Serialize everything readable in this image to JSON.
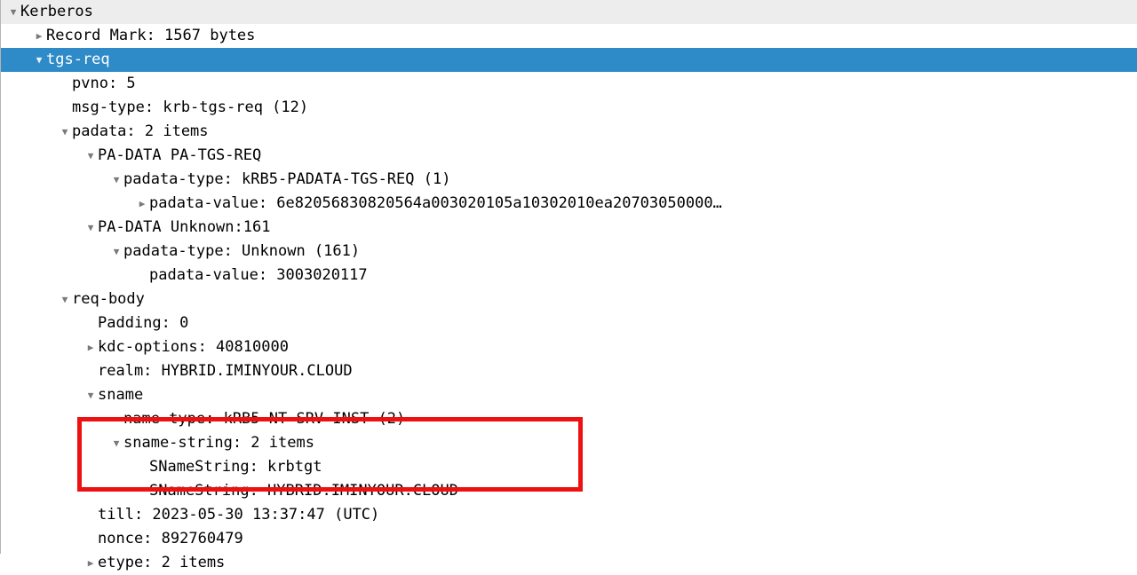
{
  "tree": {
    "rows": [
      {
        "depth": 0,
        "twisty": "expanded",
        "text": "Kerberos",
        "style": "band"
      },
      {
        "depth": 1,
        "twisty": "collapsed",
        "text": "Record Mark: 1567 bytes",
        "style": "normal"
      },
      {
        "depth": 1,
        "twisty": "expanded",
        "text": "tgs-req",
        "style": "selected"
      },
      {
        "depth": 2,
        "twisty": "none",
        "text": "pvno: 5",
        "style": "normal"
      },
      {
        "depth": 2,
        "twisty": "none",
        "text": "msg-type: krb-tgs-req (12)",
        "style": "normal"
      },
      {
        "depth": 2,
        "twisty": "expanded",
        "text": "padata: 2 items",
        "style": "normal"
      },
      {
        "depth": 3,
        "twisty": "expanded",
        "text": "PA-DATA PA-TGS-REQ",
        "style": "normal"
      },
      {
        "depth": 4,
        "twisty": "expanded",
        "text": "padata-type: kRB5-PADATA-TGS-REQ (1)",
        "style": "normal"
      },
      {
        "depth": 5,
        "twisty": "collapsed",
        "text": "padata-value: 6e82056830820564a003020105a10302010ea20703050000…",
        "style": "normal"
      },
      {
        "depth": 3,
        "twisty": "expanded",
        "text": "PA-DATA Unknown:161",
        "style": "normal"
      },
      {
        "depth": 4,
        "twisty": "expanded",
        "text": "padata-type: Unknown (161)",
        "style": "normal"
      },
      {
        "depth": 5,
        "twisty": "none",
        "text": "padata-value: 3003020117",
        "style": "normal"
      },
      {
        "depth": 2,
        "twisty": "expanded",
        "text": "req-body",
        "style": "normal"
      },
      {
        "depth": 3,
        "twisty": "none",
        "text": "Padding: 0",
        "style": "normal"
      },
      {
        "depth": 3,
        "twisty": "collapsed",
        "text": "kdc-options: 40810000",
        "style": "normal"
      },
      {
        "depth": 3,
        "twisty": "none",
        "text": "realm: HYBRID.IMINYOUR.CLOUD",
        "style": "normal"
      },
      {
        "depth": 3,
        "twisty": "expanded",
        "text": "sname",
        "style": "normal"
      },
      {
        "depth": 4,
        "twisty": "none",
        "text": "name-type: kRB5-NT-SRV-INST (2)",
        "style": "normal"
      },
      {
        "depth": 4,
        "twisty": "expanded",
        "text": "sname-string: 2 items",
        "style": "normal"
      },
      {
        "depth": 5,
        "twisty": "none",
        "text": "SNameString: krbtgt",
        "style": "normal"
      },
      {
        "depth": 5,
        "twisty": "none",
        "text": "SNameString: HYBRID.IMINYOUR.CLOUD",
        "style": "normal"
      },
      {
        "depth": 3,
        "twisty": "none",
        "text": "till: 2023-05-30 13:37:47 (UTC)",
        "style": "normal"
      },
      {
        "depth": 3,
        "twisty": "none",
        "text": "nonce: 892760479",
        "style": "normal"
      },
      {
        "depth": 3,
        "twisty": "collapsed",
        "text": "etype: 2 items",
        "style": "normal"
      }
    ]
  },
  "glyphs": {
    "expanded": "▼",
    "collapsed": "▶"
  },
  "colors": {
    "selection": "#2e8bc8",
    "header_band": "#ededed",
    "annotation": "#ee1111",
    "text": "#000000",
    "twisty": "#7a7a7a"
  },
  "annotation": {
    "shape": "rectangle",
    "target": "sname-string: 2 items"
  }
}
